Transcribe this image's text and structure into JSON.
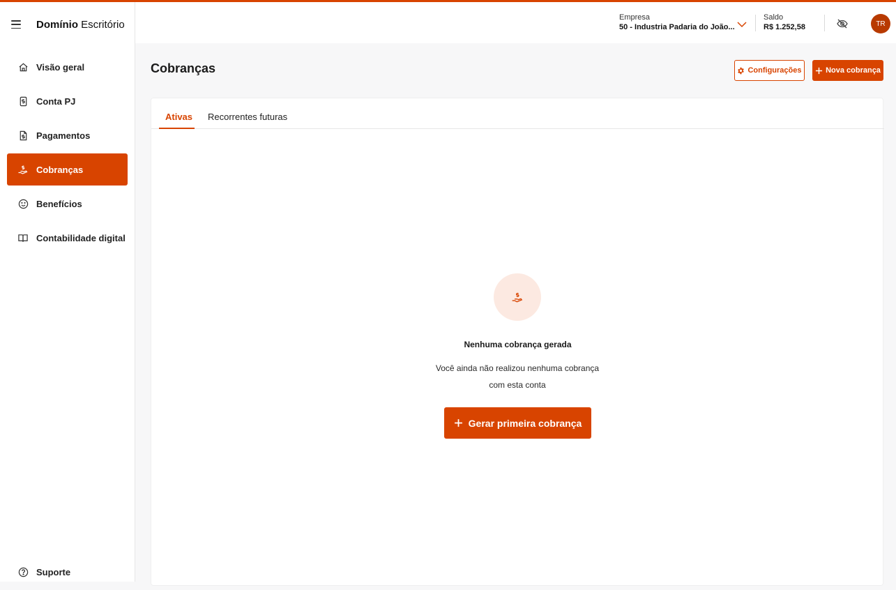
{
  "brand": {
    "bold": "Domínio",
    "regular": "Escritório"
  },
  "sidebar": {
    "items": [
      {
        "label": "Visão geral",
        "icon": "home-icon"
      },
      {
        "label": "Conta PJ",
        "icon": "dollar-document-icon"
      },
      {
        "label": "Pagamentos",
        "icon": "invoice-icon"
      },
      {
        "label": "Cobranças",
        "icon": "hand-coin-icon",
        "active": true
      },
      {
        "label": "Benefícios",
        "icon": "smile-icon"
      },
      {
        "label": "Contabilidade digital",
        "icon": "book-icon"
      }
    ],
    "support": {
      "label": "Suporte",
      "icon": "help-circle-icon"
    }
  },
  "header": {
    "company_label": "Empresa",
    "company_value": "50 - Industria Padaria do João...",
    "balance_label": "Saldo",
    "balance_value": "R$ 1.252,58",
    "avatar_initials": "TR"
  },
  "page": {
    "title": "Cobranças",
    "settings_button": "Configurações",
    "new_button": "Nova cobrança"
  },
  "tabs": [
    {
      "label": "Ativas",
      "active": true
    },
    {
      "label": "Recorrentes futuras",
      "active": false
    }
  ],
  "empty_state": {
    "title": "Nenhuma cobrança gerada",
    "line1": "Você ainda não realizou nenhuma cobrança",
    "line2": "com esta conta",
    "cta": "Gerar primeira cobrança"
  },
  "colors": {
    "accent": "#D84400",
    "accent_soft": "#FCE9E1",
    "avatar": "#B83A00"
  }
}
